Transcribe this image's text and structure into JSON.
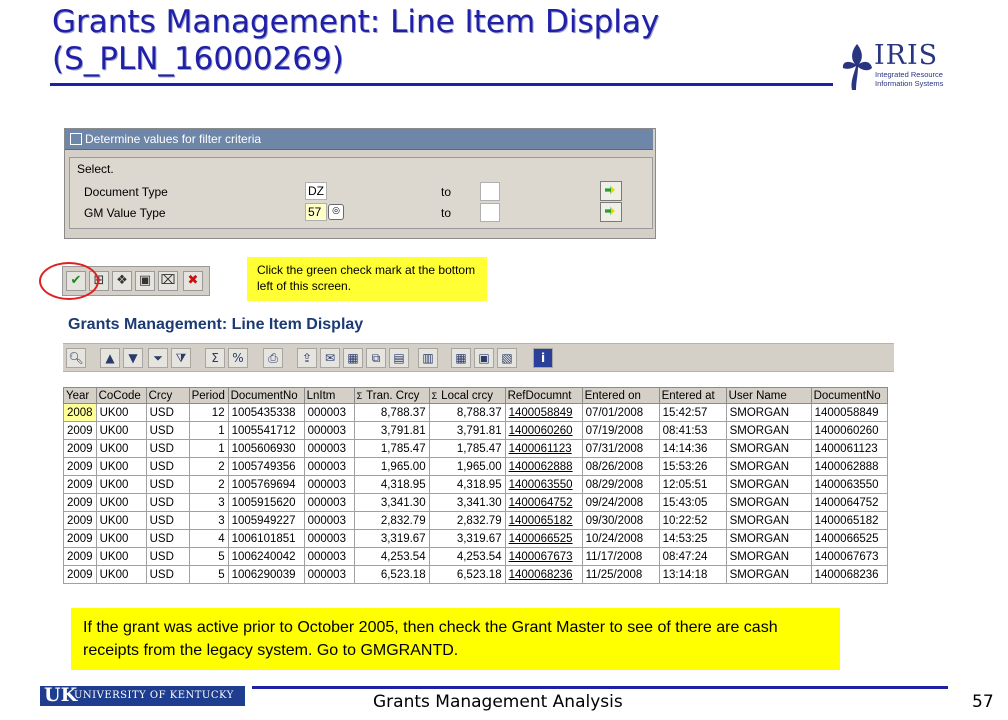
{
  "slide": {
    "title": "Grants Management: Line Item Display (S_PLN_16000269)",
    "footer": "Grants Management Analysis",
    "page_number": "57"
  },
  "logos": {
    "iris_word": "IRIS",
    "iris_sub": "Integrated Resource Information Systems",
    "uk_letters": "UK",
    "uk_text": "UNIVERSITY OF KENTUCKY"
  },
  "filter_dialog": {
    "title": "Determine values for filter criteria",
    "group_label": "Select.",
    "rows": [
      {
        "label": "Document Type",
        "value": "DZ",
        "to_label": "to"
      },
      {
        "label": "GM Value Type",
        "value": "57",
        "to_label": "to"
      }
    ]
  },
  "callouts": {
    "check_mark": "Click the green check mark at the bottom left of this screen.",
    "grant_master": "If the grant was active prior to October 2005, then check the Grant Master to see of there are cash receipts from the legacy system.  Go to GMGRANTD."
  },
  "report": {
    "title": "Grants Management: Line Item Display",
    "columns": [
      "Year",
      "CoCode",
      "Crcy",
      "Period",
      "DocumentNo",
      "LnItm",
      "Tran. Crcy",
      "Local crcy",
      "RefDocumnt",
      "Entered on",
      "Entered at",
      "User Name",
      "DocumentNo"
    ],
    "rows": [
      [
        "2008",
        "UK00",
        "USD",
        "12",
        "1005435338",
        "000003",
        "8,788.37",
        "8,788.37",
        "1400058849",
        "07/01/2008",
        "15:42:57",
        "SMORGAN",
        "1400058849"
      ],
      [
        "2009",
        "UK00",
        "USD",
        "1",
        "1005541712",
        "000003",
        "3,791.81",
        "3,791.81",
        "1400060260",
        "07/19/2008",
        "08:41:53",
        "SMORGAN",
        "1400060260"
      ],
      [
        "2009",
        "UK00",
        "USD",
        "1",
        "1005606930",
        "000003",
        "1,785.47",
        "1,785.47",
        "1400061123",
        "07/31/2008",
        "14:14:36",
        "SMORGAN",
        "1400061123"
      ],
      [
        "2009",
        "UK00",
        "USD",
        "2",
        "1005749356",
        "000003",
        "1,965.00",
        "1,965.00",
        "1400062888",
        "08/26/2008",
        "15:53:26",
        "SMORGAN",
        "1400062888"
      ],
      [
        "2009",
        "UK00",
        "USD",
        "2",
        "1005769694",
        "000003",
        "4,318.95",
        "4,318.95",
        "1400063550",
        "08/29/2008",
        "12:05:51",
        "SMORGAN",
        "1400063550"
      ],
      [
        "2009",
        "UK00",
        "USD",
        "3",
        "1005915620",
        "000003",
        "3,341.30",
        "3,341.30",
        "1400064752",
        "09/24/2008",
        "15:43:05",
        "SMORGAN",
        "1400064752"
      ],
      [
        "2009",
        "UK00",
        "USD",
        "3",
        "1005949227",
        "000003",
        "2,832.79",
        "2,832.79",
        "1400065182",
        "09/30/2008",
        "10:22:52",
        "SMORGAN",
        "1400065182"
      ],
      [
        "2009",
        "UK00",
        "USD",
        "4",
        "1006101851",
        "000003",
        "3,319.67",
        "3,319.67",
        "1400066525",
        "10/24/2008",
        "14:53:25",
        "SMORGAN",
        "1400066525"
      ],
      [
        "2009",
        "UK00",
        "USD",
        "5",
        "1006240042",
        "000003",
        "4,253.54",
        "4,253.54",
        "1400067673",
        "11/17/2008",
        "08:47:24",
        "SMORGAN",
        "1400067673"
      ],
      [
        "2009",
        "UK00",
        "USD",
        "5",
        "1006290039",
        "000003",
        "6,523.18",
        "6,523.18",
        "1400068236",
        "11/25/2008",
        "13:14:18",
        "SMORGAN",
        "1400068236"
      ]
    ]
  },
  "icons": {
    "check": "✔",
    "cancel": "✖",
    "save": "▣",
    "delete": "🗑",
    "info": "i",
    "sigma": "Σ"
  },
  "colors": {
    "title_blue": "#1f1fa8",
    "callout_yellow": "#ffff00",
    "sap_grey": "#d4d0c8",
    "oval_red": "#e02020"
  }
}
